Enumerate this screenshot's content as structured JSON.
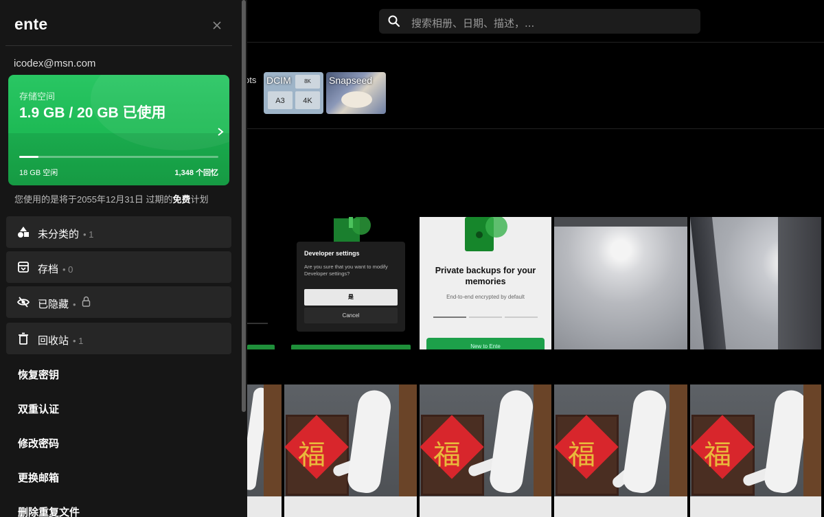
{
  "search": {
    "placeholder": "搜索相册、日期、描述，..."
  },
  "albums": {
    "cut_label": "ots",
    "items": [
      {
        "name": "DCIM",
        "tiles": [
          "A3",
          "4K"
        ]
      },
      {
        "name": "Snapseed"
      }
    ]
  },
  "grid": {
    "developer_dialog": {
      "title": "Developer settings",
      "desc": "Are you sure that you want to modify Developer settings?",
      "yes": "是",
      "cancel": "Cancel"
    },
    "private": {
      "title": "Private backups for your memories",
      "subtitle": "End-to-end encrypted by default",
      "button": "New to Ente"
    },
    "fu_char": "福"
  },
  "sidebar": {
    "logo": "ente",
    "email": "icodex@msn.com",
    "storage": {
      "label": "存储空间",
      "value": "1.9 GB / 20 GB 已使用",
      "usage_fraction": 0.095,
      "free": "18 GB 空闲",
      "memories": "1,348 个回忆"
    },
    "plan_prefix": "您使用的是将于2055年12月31日 过期的",
    "plan_bold": "免费",
    "plan_suffix": "计划",
    "cards": [
      {
        "label": "未分类的",
        "count": "• 1",
        "icon": "shapes-icon"
      },
      {
        "label": "存档",
        "count": "• 0",
        "icon": "archive-icon"
      },
      {
        "label": "已隐藏",
        "count": "•",
        "icon": "eye-off-icon"
      },
      {
        "label": "回收站",
        "count": "• 1",
        "icon": "trash-icon"
      }
    ],
    "links": [
      "恢复密钥",
      "双重认证",
      "修改密码",
      "更换邮箱",
      "删除重复文件"
    ]
  },
  "colors": {
    "accent": "#1db954",
    "sidebar_bg": "#161616",
    "card_bg": "#262626"
  }
}
